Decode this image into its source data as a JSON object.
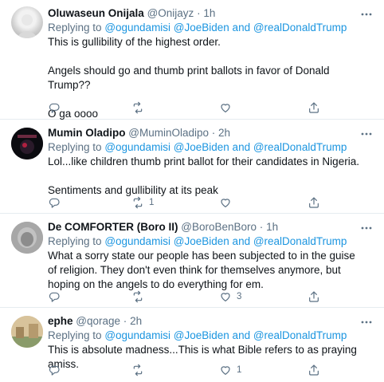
{
  "tweets": [
    {
      "name": "Oluwaseun Onijala",
      "handle": "@Onijayz",
      "time": "1h",
      "replying_prefix": "Replying to",
      "mentions": "@ogundamisi @JoeBiden and @realDonaldTrump",
      "paragraphs": [
        "This is gullibility of the highest order.",
        "Angels should go and thumb print ballots in favor of Donald Trump??",
        "O ga oooo"
      ],
      "retweets": "",
      "likes": ""
    },
    {
      "name": "Mumin Oladipo",
      "handle": "@MuminOladipo",
      "time": "2h",
      "replying_prefix": "Replying to",
      "mentions": "@ogundamisi @JoeBiden and @realDonaldTrump",
      "paragraphs": [
        "Lol...like children thumb print ballot for their candidates in Nigeria.",
        "Sentiments and gullibility at its peak"
      ],
      "retweets": "1",
      "likes": ""
    },
    {
      "name": "De COMFORTER (Boro II)",
      "handle": "@BoroBenBoro",
      "time": "1h",
      "replying_prefix": "Replying to",
      "mentions": "@ogundamisi @JoeBiden and @realDonaldTrump",
      "paragraphs": [
        "What a sorry state our people has been subjected to in the guise of religion. They don't even think for themselves anymore, but hoping on the angels to do everything for em."
      ],
      "retweets": "",
      "likes": "3"
    },
    {
      "name": "ephe",
      "handle": "@qorage",
      "time": "2h",
      "replying_prefix": "Replying to",
      "mentions": "@ogundamisi @JoeBiden and @realDonaldTrump",
      "paragraphs": [
        "This is absolute madness...This is what Bible refers to as praying amiss."
      ],
      "retweets": "",
      "likes": "1"
    }
  ],
  "icons": {
    "reply": "reply-icon",
    "retweet": "retweet-icon",
    "like": "heart-icon",
    "share": "share-icon",
    "more": "more-options-icon"
  },
  "colors": {
    "link": "#1b95e0",
    "secondary_text": "#5b7083",
    "divider": "#e6ecf0"
  }
}
